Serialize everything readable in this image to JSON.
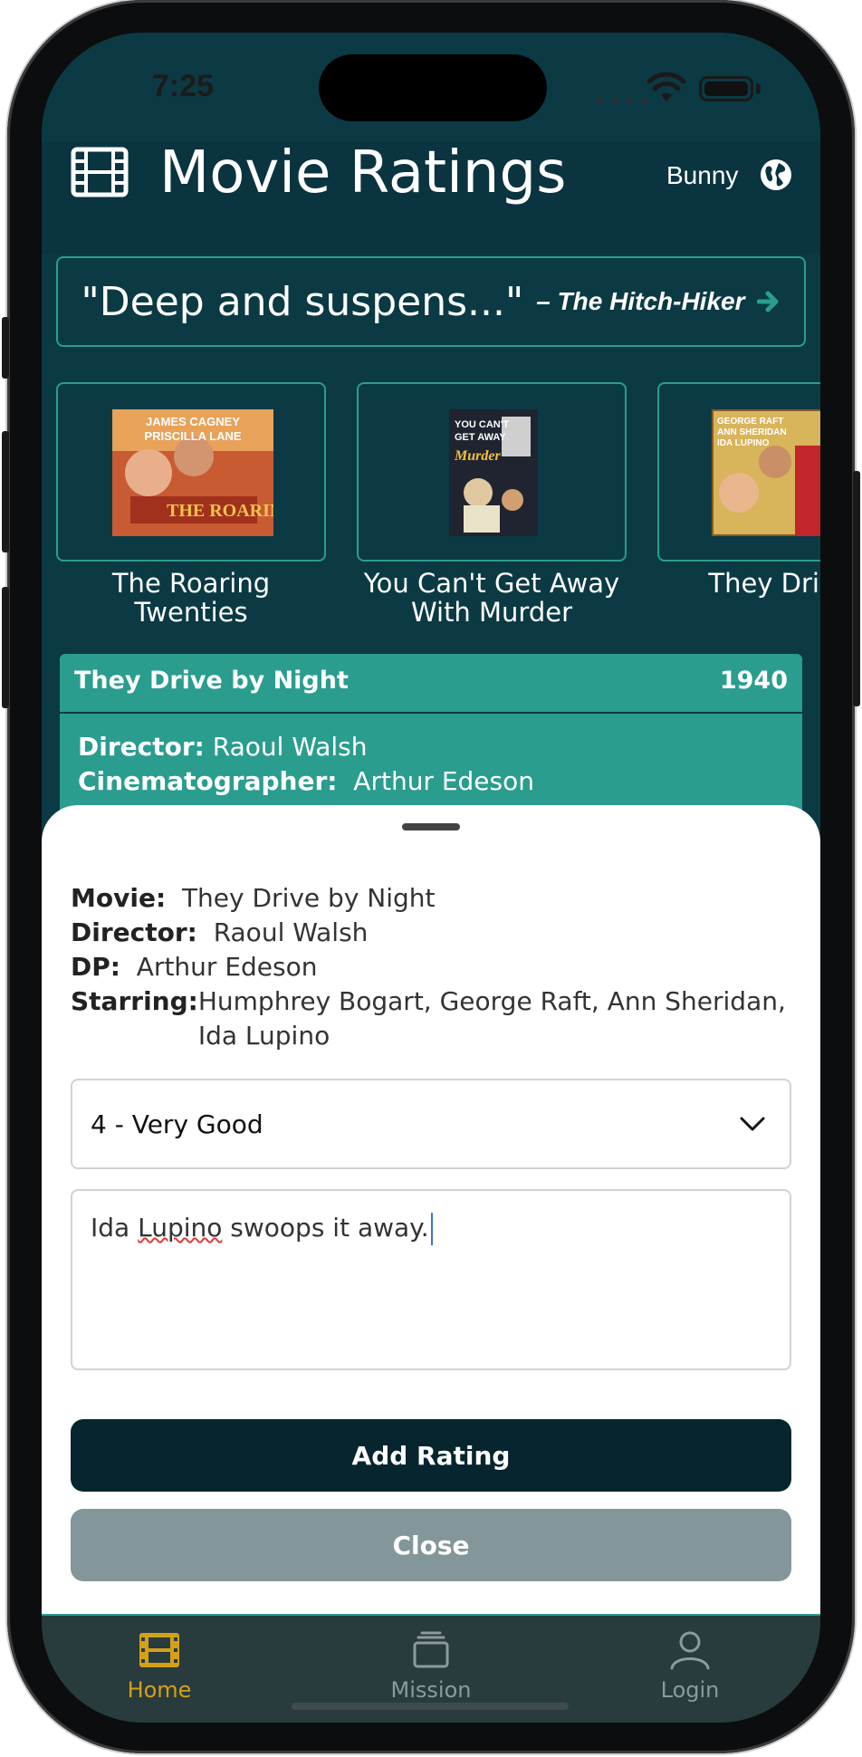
{
  "status": {
    "time": "7:25",
    "signal_dots": "••••"
  },
  "header": {
    "title": "Movie Ratings",
    "user": "Bunny"
  },
  "quote": {
    "text": "\"Deep and suspens...\"",
    "source": "– The Hitch-Hiker"
  },
  "carousel": [
    {
      "title": "The Roaring Twenties"
    },
    {
      "title": "You Can't Get Away With Murder"
    },
    {
      "title": "They Drive b"
    }
  ],
  "detail": {
    "title": "They Drive by Night",
    "year": "1940",
    "director_label": "Director:",
    "director": "Raoul Walsh",
    "cinematographer_label": "Cinematographer:",
    "cinematographer": "Arthur Edeson"
  },
  "sheet": {
    "movie_label": "Movie:",
    "movie": "They Drive by Night",
    "director_label": "Director:",
    "director": "Raoul Walsh",
    "dp_label": "DP:",
    "dp": "Arthur Edeson",
    "starring_label": "Starring:",
    "starring": "Humphrey Bogart, George Raft, Ann Sheridan, Ida Lupino",
    "rating_selected": "4 - Very Good",
    "comment_part1": "Ida ",
    "comment_part2": "Lupino",
    "comment_part3": " swoops it away.",
    "add_button": "Add Rating",
    "close_button": "Close"
  },
  "tabs": [
    {
      "label": "Home",
      "icon": "film-icon",
      "active": true
    },
    {
      "label": "Mission",
      "icon": "stack-icon",
      "active": false
    },
    {
      "label": "Login",
      "icon": "user-icon",
      "active": false
    }
  ],
  "colors": {
    "brand_dark": "#0b3a44",
    "accent": "#2a9d8f",
    "tab_active": "#d4a017",
    "tab_inactive": "#8c9a9c"
  }
}
